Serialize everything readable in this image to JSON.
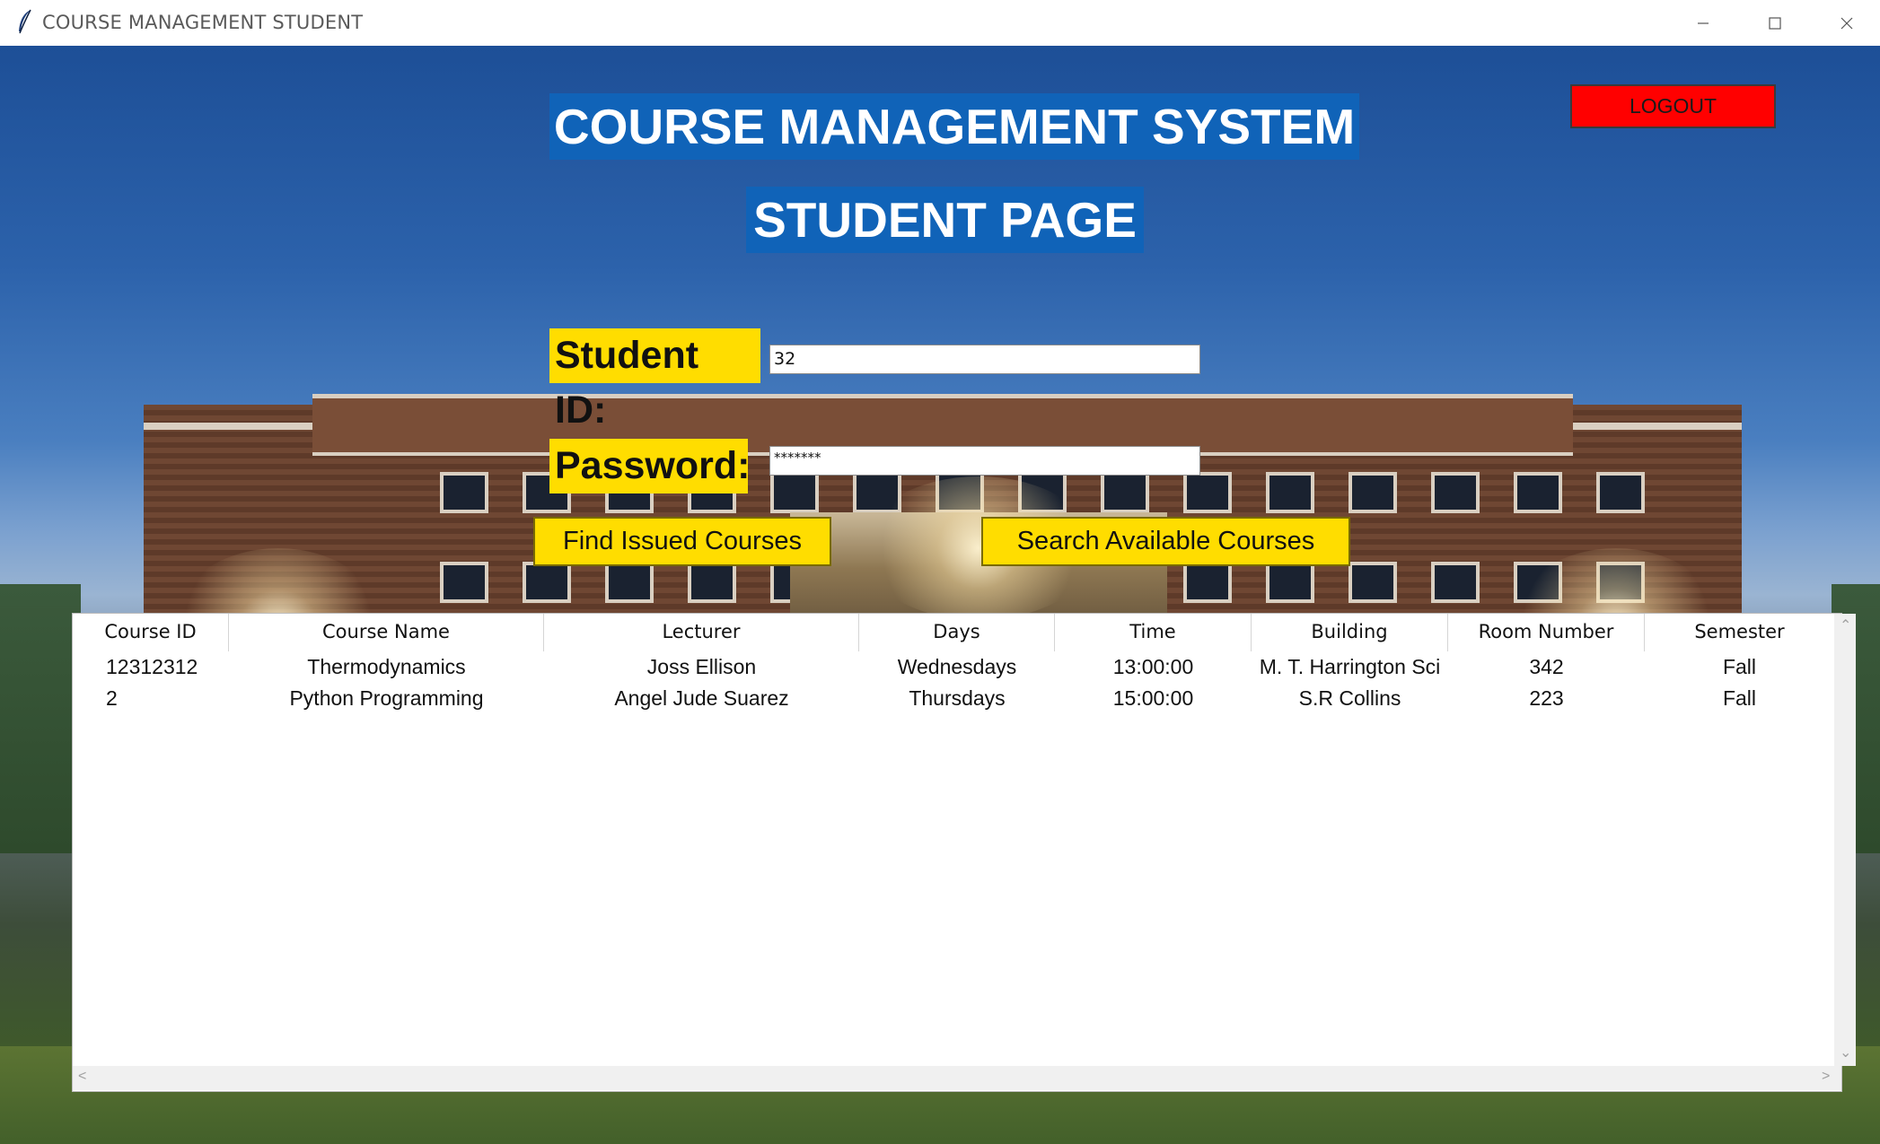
{
  "window": {
    "title": "COURSE MANAGEMENT STUDENT",
    "app_icon": "feather-icon",
    "controls": [
      "minimize-icon",
      "maximize-icon",
      "close-icon"
    ]
  },
  "header": {
    "title": "COURSE MANAGEMENT SYSTEM",
    "subtitle": "STUDENT PAGE"
  },
  "logout_label": "LOGOUT",
  "form": {
    "student_id_label": "Student ID:",
    "student_id_value": "32",
    "password_label": "Password:",
    "password_value": "*******"
  },
  "buttons": {
    "find_issued": "Find Issued Courses",
    "search_available": "Search Available Courses"
  },
  "table": {
    "columns": [
      "Course ID",
      "Course Name",
      "Lecturer",
      "Days",
      "Time",
      "Building",
      "Room Number",
      "Semester"
    ],
    "rows": [
      [
        "12312312",
        "Thermodynamics",
        "Joss Ellison",
        "Wednesdays",
        "13:00:00",
        "M. T. Harrington Sci",
        "342",
        "Fall"
      ],
      [
        "2",
        "Python Programming",
        "Angel Jude Suarez",
        "Thursdays",
        "15:00:00",
        "S.R Collins",
        "223",
        "Fall"
      ]
    ]
  },
  "colors": {
    "header_bg": "#1063b8",
    "label_bg": "#ffdd00",
    "logout_bg": "#ff0000"
  }
}
